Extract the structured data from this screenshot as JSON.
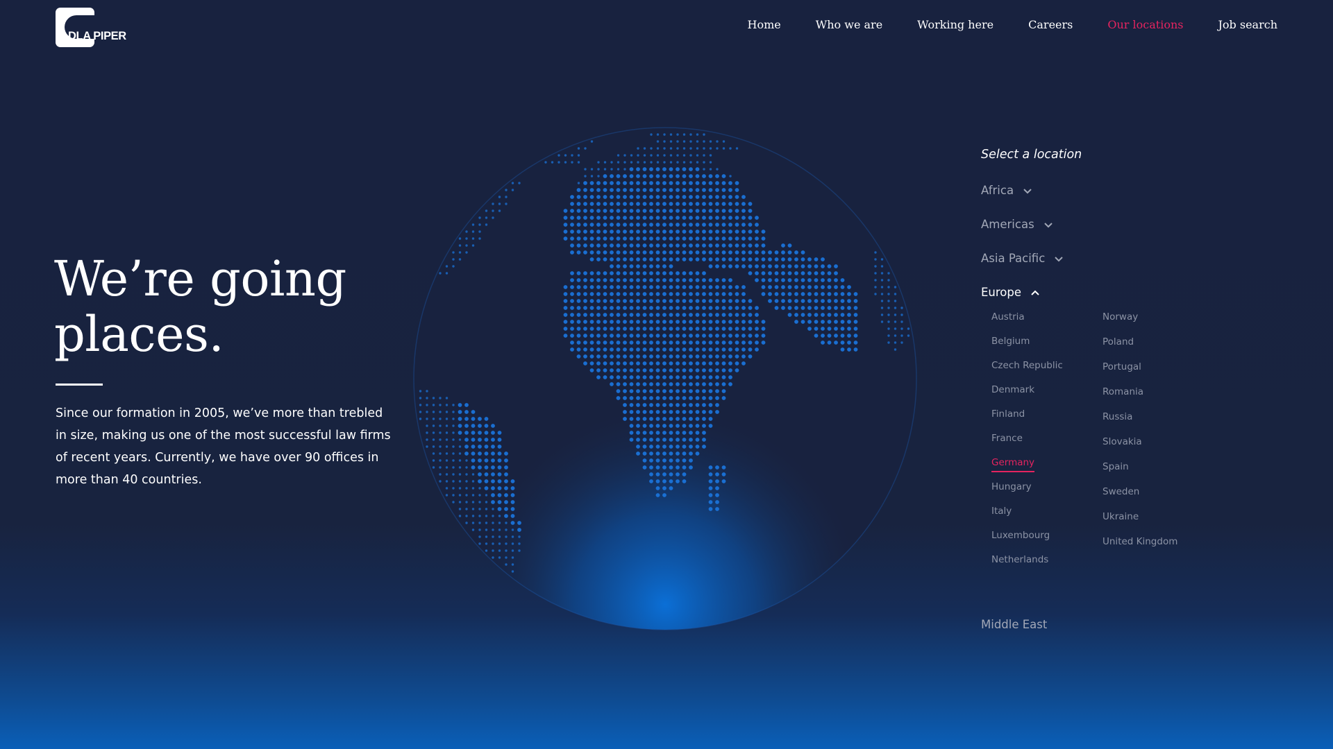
{
  "brand": {
    "logo_text": "DLA PIPER"
  },
  "nav": {
    "items": [
      {
        "label": "Home"
      },
      {
        "label": "Who we are"
      },
      {
        "label": "Working here"
      },
      {
        "label": "Careers"
      },
      {
        "label": "Our locations",
        "active": true
      },
      {
        "label": "Job search"
      }
    ]
  },
  "hero": {
    "headline_line1": "We’re going",
    "headline_line2": "places.",
    "intro": "Since our formation in 2005, we’ve more than trebled in size, making us one of the most successful law firms of recent years. Currently, we have over 90 offices in more than 40 countries."
  },
  "locations": {
    "title": "Select a location",
    "regions": [
      {
        "label": "Africa",
        "expanded": false
      },
      {
        "label": "Americas",
        "expanded": false
      },
      {
        "label": "Asia Pacific",
        "expanded": false
      },
      {
        "label": "Europe",
        "expanded": true
      },
      {
        "label": "Middle East",
        "expanded": false
      }
    ],
    "europe_col1": [
      "Austria",
      "Belgium",
      "Czech Republic",
      "Denmark",
      "Finland",
      "France",
      "Germany",
      "Hungary",
      "Italy",
      "Luxembourg",
      "Netherlands"
    ],
    "europe_col2": [
      "Norway",
      "Poland",
      "Portugal",
      "Romania",
      "Russia",
      "Slovakia",
      "Spain",
      "Sweden",
      "Ukraine",
      "United Kingdom"
    ],
    "selected_country": "Germany"
  },
  "colors": {
    "background": "#18223f",
    "accent": "#e5245f",
    "globe_dots": "#1a73d9",
    "muted_text": "#a2a8b7"
  },
  "icons": {
    "collapsed": "chevron-down-icon",
    "expanded": "chevron-up-icon"
  }
}
